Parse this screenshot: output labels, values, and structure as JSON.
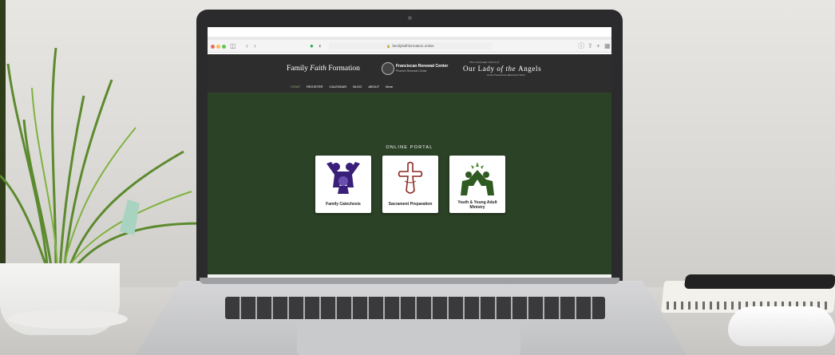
{
  "browser": {
    "url": "familyfaithformation.online"
  },
  "site": {
    "brand_prefix": "Family ",
    "brand_italic": "Faith",
    "brand_suffix": " Formation",
    "frc_name": "Franciscan Renewal Center",
    "frc_sub": "Phoenix Renewal Center",
    "olqa_top": "The Conventual Church of",
    "olqa_main_a": "Our Lady",
    "olqa_main_b": " of the ",
    "olqa_main_c": "Angels",
    "olqa_sub": "at the Franciscan Renewal Center",
    "nav": [
      "HOME",
      "REGISTER",
      "CALENDAR",
      "BLOG",
      "ABOUT",
      "More"
    ]
  },
  "portal": {
    "title": "ONLINE PORTAL",
    "cards": [
      {
        "label": "Family Catechesis",
        "icon": "family-icon",
        "color": "#3a1f7a"
      },
      {
        "label": "Sacrament Preparation",
        "icon": "cross-icon",
        "color": "#8a2a24"
      },
      {
        "label": "Youth & Young Adult",
        "label2": "Ministry",
        "icon": "youth-icon",
        "color": "#2f5a22"
      }
    ]
  },
  "colors": {
    "hero_bg": "#2b4226",
    "header_bg": "#2d2d2d"
  }
}
